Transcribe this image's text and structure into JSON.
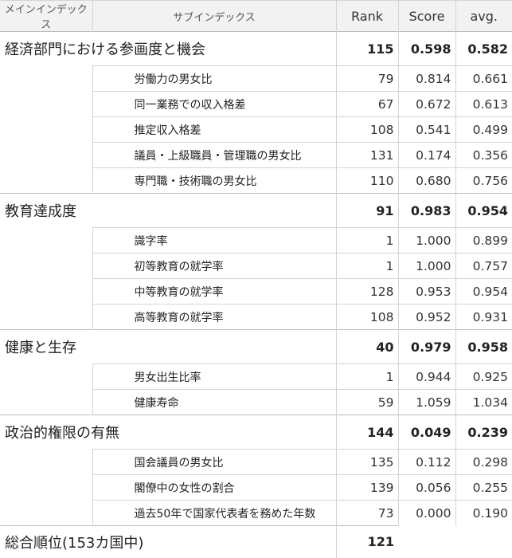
{
  "header": {
    "main": "メインインデックス",
    "sub": "サブインデックス",
    "rank": "Rank",
    "score": "Score",
    "avg": "avg."
  },
  "sections": [
    {
      "name": "経済部門における参画度と機会",
      "rank": "115",
      "score": "0.598",
      "avg": "0.582",
      "items": [
        {
          "name": "労働力の男女比",
          "rank": "79",
          "score": "0.814",
          "avg": "0.661"
        },
        {
          "name": "同一業務での収入格差",
          "rank": "67",
          "score": "0.672",
          "avg": "0.613"
        },
        {
          "name": "推定収入格差",
          "rank": "108",
          "score": "0.541",
          "avg": "0.499"
        },
        {
          "name": "議員・上級職員・管理職の男女比",
          "rank": "131",
          "score": "0.174",
          "avg": "0.356"
        },
        {
          "name": "専門職・技術職の男女比",
          "rank": "110",
          "score": "0.680",
          "avg": "0.756"
        }
      ]
    },
    {
      "name": "教育達成度",
      "rank": "91",
      "score": "0.983",
      "avg": "0.954",
      "items": [
        {
          "name": "識字率",
          "rank": "1",
          "score": "1.000",
          "avg": "0.899"
        },
        {
          "name": "初等教育の就学率",
          "rank": "1",
          "score": "1.000",
          "avg": "0.757"
        },
        {
          "name": "中等教育の就学率",
          "rank": "128",
          "score": "0.953",
          "avg": "0.954"
        },
        {
          "name": "高等教育の就学率",
          "rank": "108",
          "score": "0.952",
          "avg": "0.931"
        }
      ]
    },
    {
      "name": "健康と生存",
      "rank": "40",
      "score": "0.979",
      "avg": "0.958",
      "items": [
        {
          "name": "男女出生比率",
          "rank": "1",
          "score": "0.944",
          "avg": "0.925"
        },
        {
          "name": "健康寿命",
          "rank": "59",
          "score": "1.059",
          "avg": "1.034"
        }
      ]
    },
    {
      "name": "政治的権限の有無",
      "rank": "144",
      "score": "0.049",
      "avg": "0.239",
      "items": [
        {
          "name": "国会議員の男女比",
          "rank": "135",
          "score": "0.112",
          "avg": "0.298"
        },
        {
          "name": "閣僚中の女性の割合",
          "rank": "139",
          "score": "0.056",
          "avg": "0.255"
        },
        {
          "name": "過去50年で国家代表者を務めた年数",
          "rank": "73",
          "score": "0.000",
          "avg": "0.190"
        }
      ]
    }
  ],
  "total": {
    "name": "総合順位(153カ国中)",
    "rank": "121"
  }
}
